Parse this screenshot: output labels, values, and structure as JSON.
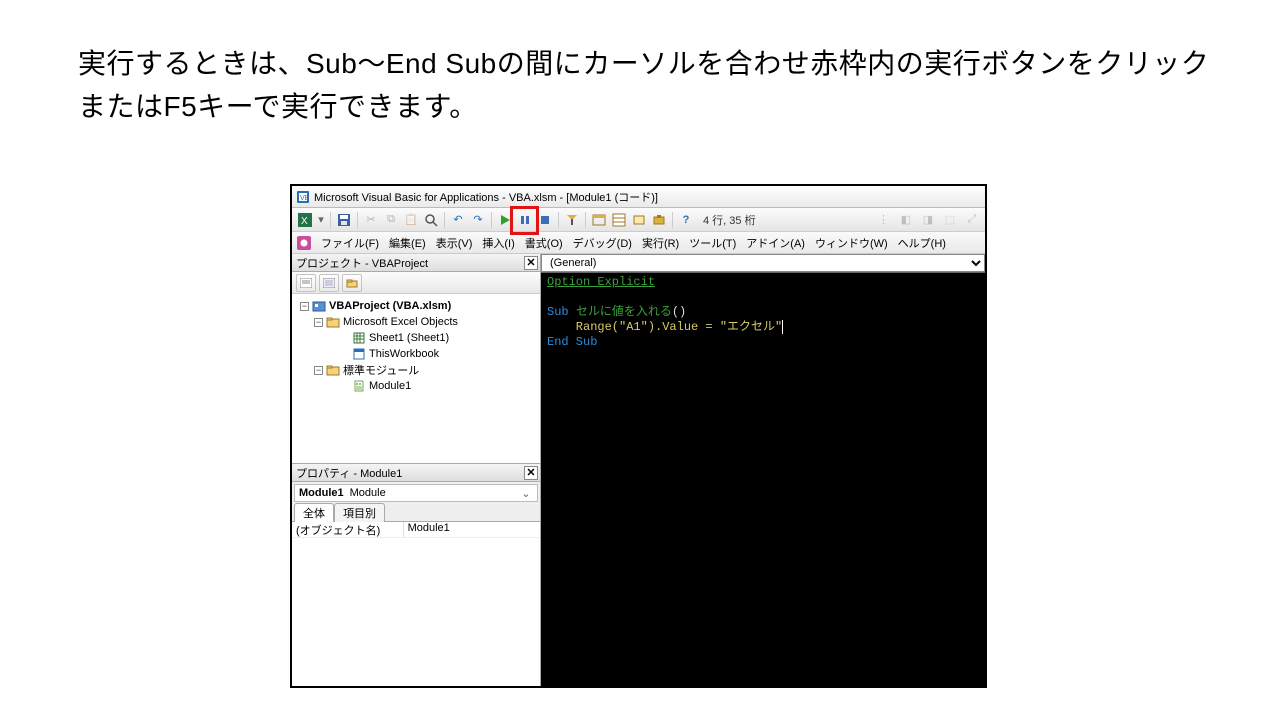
{
  "caption": "実行するときは、Sub～End Subの間にカーソルを合わせ赤枠内の実行ボタンをクリックまたはF5キーで実行できます。",
  "window_title": "Microsoft Visual Basic for Applications - VBA.xlsm - [Module1 (コード)]",
  "position_info": "4 行, 35 桁",
  "menus": {
    "file": "ファイル(F)",
    "edit": "編集(E)",
    "view": "表示(V)",
    "insert": "挿入(I)",
    "format": "書式(O)",
    "debug": "デバッグ(D)",
    "run": "実行(R)",
    "tools": "ツール(T)",
    "addins": "アドイン(A)",
    "window": "ウィンドウ(W)",
    "help": "ヘルプ(H)"
  },
  "project_pane": {
    "title": "プロジェクト - VBAProject",
    "root": "VBAProject (VBA.xlsm)",
    "excel_objects": "Microsoft Excel Objects",
    "sheet1": "Sheet1 (Sheet1)",
    "thisworkbook": "ThisWorkbook",
    "std_modules": "標準モジュール",
    "module1": "Module1"
  },
  "props_pane": {
    "title": "プロパティ - Module1",
    "object_name": "Module1",
    "object_type": "Module",
    "tab_all": "全体",
    "tab_cat": "項目別",
    "row1_key": "(オブジェクト名)",
    "row1_val": "Module1"
  },
  "code_combo": "(General)",
  "code": {
    "option": "Option Explicit",
    "sub_kw": "Sub",
    "sub_name": "セルに値を入れる",
    "parens": "()",
    "line": "    Range(\"A1\").Value = ",
    "str": "\"エクセル\"",
    "end": "End Sub"
  }
}
